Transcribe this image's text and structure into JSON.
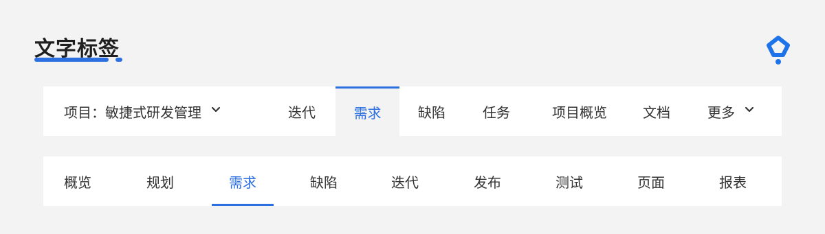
{
  "header": {
    "title": "文字标签"
  },
  "colors": {
    "accent": "#2b6fe0",
    "text": "#333333",
    "background": "#f3f3f3"
  },
  "top_nav": {
    "project_label": "项目：敏捷式研发管理",
    "items": [
      {
        "label": "迭代"
      },
      {
        "label": "需求",
        "active": true
      },
      {
        "label": "缺陷"
      },
      {
        "label": "任务"
      },
      {
        "label": "项目概览"
      },
      {
        "label": "文档"
      }
    ],
    "more_label": "更多"
  },
  "sub_nav": {
    "items": [
      {
        "label": "概览"
      },
      {
        "label": "规划"
      },
      {
        "label": "需求",
        "active": true
      },
      {
        "label": "缺陷"
      },
      {
        "label": "迭代"
      },
      {
        "label": "发布"
      },
      {
        "label": "测试"
      },
      {
        "label": "页面"
      },
      {
        "label": "报表"
      }
    ]
  },
  "icons": {
    "logo": "brand-logo-icon",
    "dropdown": "chevron-down-icon"
  }
}
